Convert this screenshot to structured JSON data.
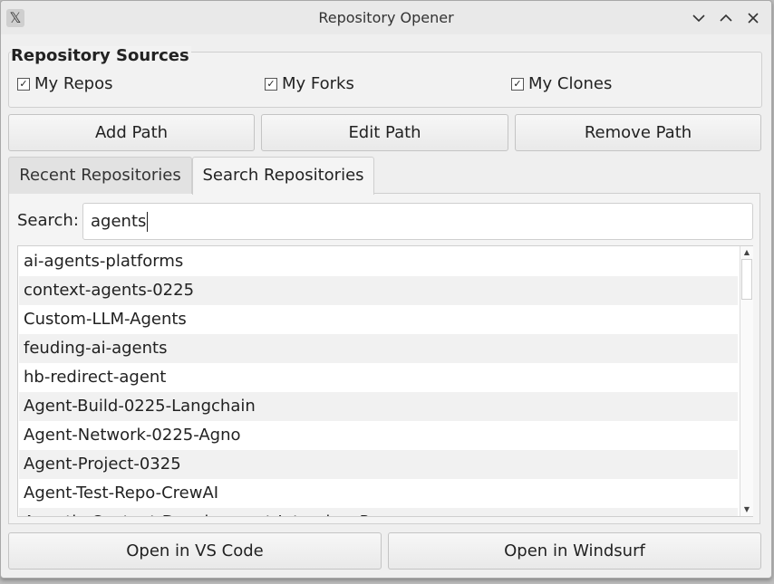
{
  "window": {
    "title": "Repository Opener"
  },
  "sources": {
    "group_title": "Repository Sources",
    "checkboxes": [
      {
        "label": "My Repos",
        "checked": true
      },
      {
        "label": "My Forks",
        "checked": true
      },
      {
        "label": "My Clones",
        "checked": true
      }
    ]
  },
  "path_buttons": {
    "add": "Add Path",
    "edit": "Edit Path",
    "remove": "Remove Path"
  },
  "tabs": [
    {
      "label": "Recent Repositories",
      "active": false
    },
    {
      "label": "Search Repositories",
      "active": true
    }
  ],
  "search": {
    "label": "Search:",
    "value": "agents"
  },
  "results": [
    "ai-agents-platforms",
    "context-agents-0225",
    "Custom-LLM-Agents",
    "feuding-ai-agents",
    "hb-redirect-agent",
    "Agent-Build-0225-Langchain",
    "Agent-Network-0225-Agno",
    "Agent-Project-0325",
    "Agent-Test-Repo-CrewAI",
    "Agentic-Content-Development-Interview-Prep"
  ],
  "actions": {
    "vscode": "Open in VS Code",
    "windsurf": "Open in Windsurf"
  },
  "icons": {
    "app": "x-app-icon",
    "check": "checkmark-icon"
  }
}
